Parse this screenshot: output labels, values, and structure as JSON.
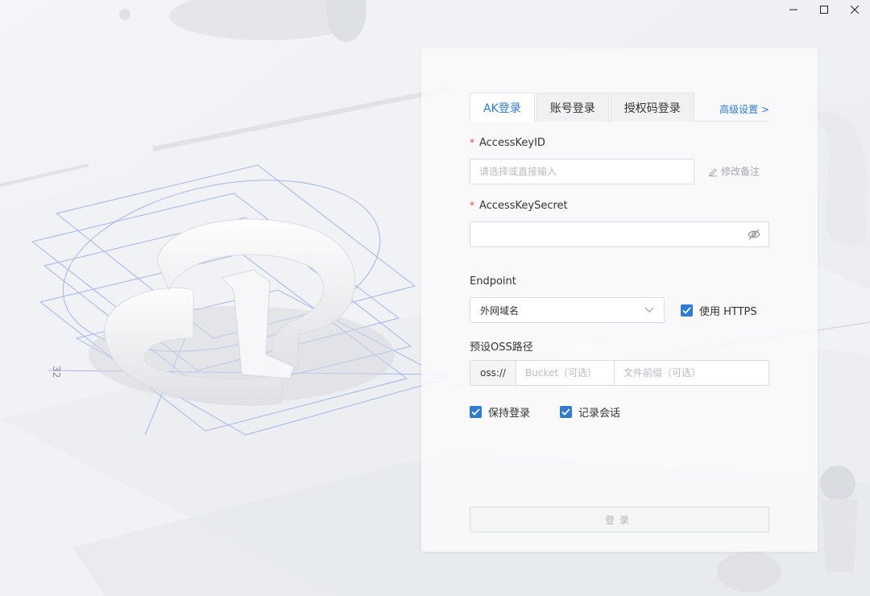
{
  "window": {
    "minimize_icon": "minimize-icon",
    "maximize_icon": "maximize-icon",
    "close_icon": "close-icon"
  },
  "tabs": [
    {
      "label": "AK登录",
      "active": true
    },
    {
      "label": "账号登录",
      "active": false
    },
    {
      "label": "授权码登录",
      "active": false
    }
  ],
  "advanced_link": "高级设置 >",
  "access_key_id": {
    "required_mark": "*",
    "label": "AccessKeyID",
    "placeholder": "请选择或直接输入",
    "value": "",
    "edit_note": "修改备注"
  },
  "access_key_secret": {
    "required_mark": "*",
    "label": "AccessKeySecret",
    "value": "",
    "toggle_icon": "eye-slash-icon"
  },
  "endpoint": {
    "label": "Endpoint",
    "selected": "外网域名",
    "use_https_label": "使用 HTTPS",
    "use_https_checked": true
  },
  "oss_path": {
    "label": "预设OSS路径",
    "prefix": "oss://",
    "bucket_placeholder": "Bucket（可选）",
    "path_placeholder": "文件前缀（可选）"
  },
  "options": {
    "keep_login_label": "保持登录",
    "keep_login_checked": true,
    "record_session_label": "记录会话",
    "record_session_checked": true
  },
  "login_button": "登录",
  "background": {
    "dimension_label": "32"
  },
  "colors": {
    "accent": "#2f7bd0",
    "required": "#e04b4b"
  }
}
